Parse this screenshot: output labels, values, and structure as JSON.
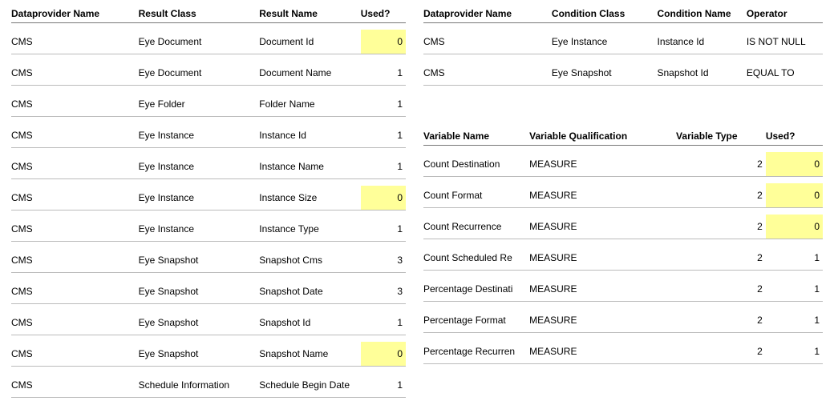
{
  "results": {
    "headers": {
      "dp": "Dataprovider Name",
      "rclass": "Result Class",
      "rname": "Result Name",
      "used": "Used?"
    },
    "rows": [
      {
        "dp": "CMS",
        "rclass": "Eye Document",
        "rname": "Document Id",
        "used": 0,
        "hl": true
      },
      {
        "dp": "CMS",
        "rclass": "Eye Document",
        "rname": "Document Name",
        "used": 1,
        "hl": false
      },
      {
        "dp": "CMS",
        "rclass": "Eye Folder",
        "rname": "Folder Name",
        "used": 1,
        "hl": false
      },
      {
        "dp": "CMS",
        "rclass": "Eye Instance",
        "rname": "Instance Id",
        "used": 1,
        "hl": false
      },
      {
        "dp": "CMS",
        "rclass": "Eye Instance",
        "rname": "Instance Name",
        "used": 1,
        "hl": false
      },
      {
        "dp": "CMS",
        "rclass": "Eye Instance",
        "rname": "Instance Size",
        "used": 0,
        "hl": true
      },
      {
        "dp": "CMS",
        "rclass": "Eye Instance",
        "rname": "Instance Type",
        "used": 1,
        "hl": false
      },
      {
        "dp": "CMS",
        "rclass": "Eye Snapshot",
        "rname": "Snapshot Cms",
        "used": 3,
        "hl": false
      },
      {
        "dp": "CMS",
        "rclass": "Eye Snapshot",
        "rname": "Snapshot Date",
        "used": 3,
        "hl": false
      },
      {
        "dp": "CMS",
        "rclass": "Eye Snapshot",
        "rname": "Snapshot Id",
        "used": 1,
        "hl": false
      },
      {
        "dp": "CMS",
        "rclass": "Eye Snapshot",
        "rname": "Snapshot Name",
        "used": 0,
        "hl": true
      },
      {
        "dp": "CMS",
        "rclass": "Schedule Information",
        "rname": "Schedule Begin Date",
        "used": 1,
        "hl": false
      }
    ]
  },
  "conditions": {
    "headers": {
      "dp": "Dataprovider Name",
      "cclass": "Condition Class",
      "cname": "Condition Name",
      "op": "Operator"
    },
    "rows": [
      {
        "dp": "CMS",
        "cclass": "Eye Instance",
        "cname": "Instance Id",
        "op": "IS NOT NULL"
      },
      {
        "dp": "CMS",
        "cclass": "Eye Snapshot",
        "cname": "Snapshot Id",
        "op": "EQUAL TO"
      }
    ]
  },
  "variables": {
    "headers": {
      "vname": "Variable Name",
      "vqual": "Variable Qualification",
      "vtype": "Variable Type",
      "used": "Used?"
    },
    "rows": [
      {
        "vname": "Count Destination",
        "vqual": "MEASURE",
        "vtype": 2,
        "used": 0,
        "hl": true
      },
      {
        "vname": "Count Format",
        "vqual": "MEASURE",
        "vtype": 2,
        "used": 0,
        "hl": true
      },
      {
        "vname": "Count Recurrence",
        "vqual": "MEASURE",
        "vtype": 2,
        "used": 0,
        "hl": true
      },
      {
        "vname": "Count Scheduled Re",
        "vqual": "MEASURE",
        "vtype": 2,
        "used": 1,
        "hl": false
      },
      {
        "vname": "Percentage Destinati",
        "vqual": "MEASURE",
        "vtype": 2,
        "used": 1,
        "hl": false
      },
      {
        "vname": "Percentage Format",
        "vqual": "MEASURE",
        "vtype": 2,
        "used": 1,
        "hl": false
      },
      {
        "vname": "Percentage Recurren",
        "vqual": "MEASURE",
        "vtype": 2,
        "used": 1,
        "hl": false
      }
    ]
  }
}
